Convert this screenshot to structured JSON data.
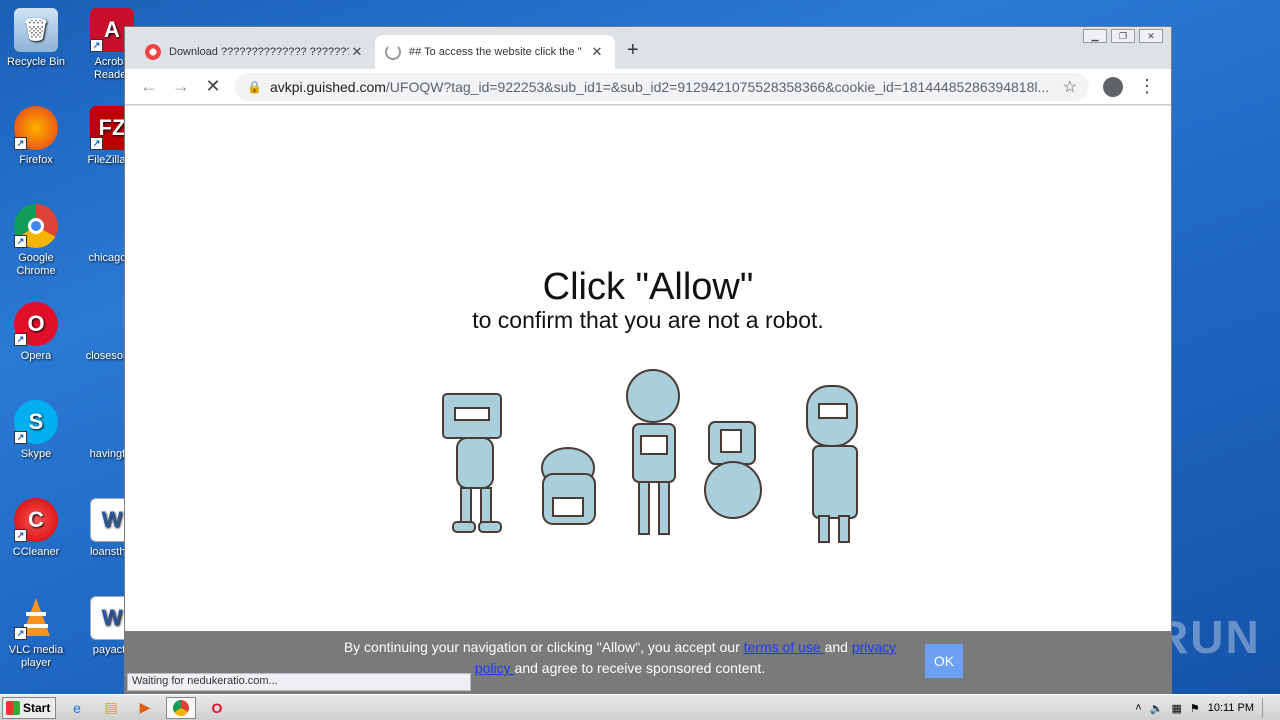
{
  "desktop": {
    "icons": [
      {
        "label": "Recycle Bin",
        "icon": "recycle-bin-icon"
      },
      {
        "label": "Acroba Reader",
        "icon": "acrobat-icon"
      },
      {
        "label": "Firefox",
        "icon": "firefox-icon"
      },
      {
        "label": "FileZilla C",
        "icon": "filezilla-icon"
      },
      {
        "label": "Google Chrome",
        "icon": "chrome-icon"
      },
      {
        "label": "chicagoto",
        "icon": "file-icon"
      },
      {
        "label": "Opera",
        "icon": "opera-icon"
      },
      {
        "label": "closesome",
        "icon": "file-icon"
      },
      {
        "label": "Skype",
        "icon": "skype-icon"
      },
      {
        "label": "havingfitr",
        "icon": "file-icon"
      },
      {
        "label": "CCleaner",
        "icon": "ccleaner-icon"
      },
      {
        "label": "loansthin",
        "icon": "word-doc-icon"
      },
      {
        "label": "VLC media player",
        "icon": "vlc-icon"
      },
      {
        "label": "payactu",
        "icon": "word-doc-icon"
      }
    ]
  },
  "browser": {
    "tabs": [
      {
        "title": "Download ?????????????? ??????? ???",
        "active": false
      },
      {
        "title": "## To access the website click the \"",
        "active": true
      }
    ],
    "address": {
      "host": "avkpi.guished.com",
      "path": "/UFOQW?tag_id=922253&sub_id1=&sub_id2=9129421075528358366&cookie_id=18144485286394818l..."
    },
    "status_text": "Waiting for nedukeratio.com..."
  },
  "page": {
    "headline": "Click \"Allow\"",
    "subline": "to confirm that you are not a robot.",
    "cookie": {
      "text_before": "By continuing your navigation or clicking \"Allow\", you accept our ",
      "terms_link": "terms of use ",
      "and": "and ",
      "privacy_link": "privacy policy ",
      "text_after": "and agree to receive sponsored content.",
      "ok_label": "OK"
    }
  },
  "watermark": "ANY RUN",
  "taskbar": {
    "start_label": "Start",
    "clock": "10:11 PM"
  }
}
